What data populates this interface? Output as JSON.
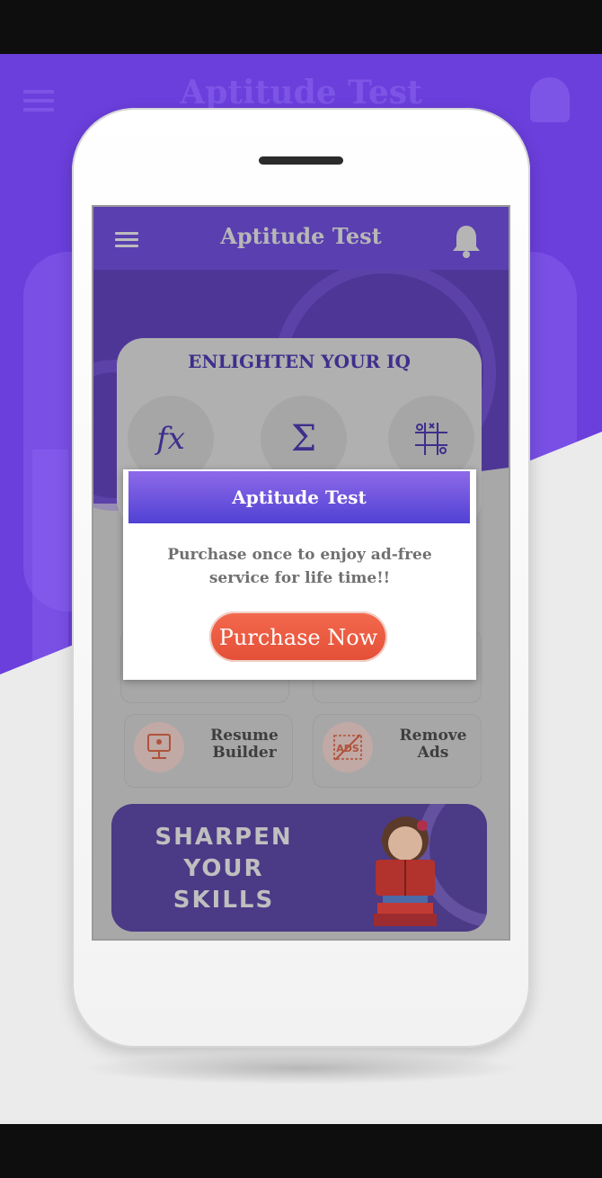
{
  "app": {
    "title": "Aptitude Test",
    "background_title": "Aptitude Test"
  },
  "card": {
    "title": "ENLIGHTEN YOUR IQ",
    "features": [
      {
        "icon": "function-icon",
        "glyph": "fx"
      },
      {
        "icon": "sigma-icon",
        "glyph": "Σ"
      },
      {
        "icon": "tic-tac-toe-icon",
        "glyph": "#"
      }
    ]
  },
  "tiles": [
    {
      "label_line1": "Resume",
      "label_line2": "Builder",
      "icon": "resume-icon"
    },
    {
      "label_line1": "Remove",
      "label_line2": "Ads",
      "icon": "ads-icon",
      "icon_text": "ADS"
    }
  ],
  "banner": {
    "lines": [
      "SHARPEN",
      "YOUR",
      "SKILLS"
    ]
  },
  "dialog": {
    "title": "Aptitude Test",
    "message": "Purchase once to enjoy ad-free service for life time!!",
    "button_label": "Purchase Now"
  },
  "colors": {
    "brand_purple": "#6b3fdc",
    "button_orange": "#ee5a40"
  }
}
